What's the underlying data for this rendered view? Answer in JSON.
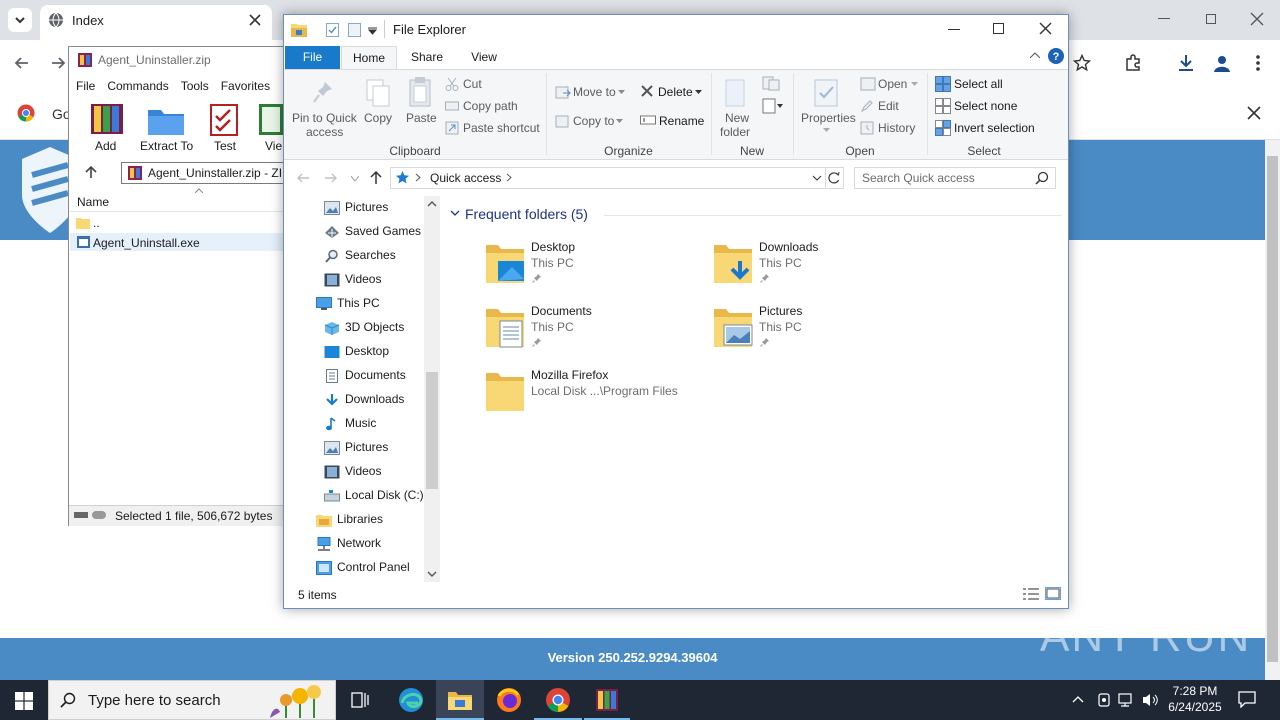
{
  "browser": {
    "tab_title": "Index",
    "bookmark_prefix": "Go",
    "site_version": "Version 250.252.9294.39604",
    "watermark": "ANY RUN"
  },
  "winrar": {
    "title": "Agent_Uninstaller.zip",
    "menu": [
      "File",
      "Commands",
      "Tools",
      "Favorites"
    ],
    "toolbar": [
      "Add",
      "Extract To",
      "Test",
      "Vie"
    ],
    "path": "Agent_Uninstaller.zip - ZIP",
    "col_name": "Name",
    "rows": [
      "..",
      "Agent_Uninstall.exe"
    ],
    "status": "Selected 1 file, 506,672 bytes"
  },
  "explorer": {
    "title": "File Explorer",
    "tabs": {
      "file": "File",
      "home": "Home",
      "share": "Share",
      "view": "View"
    },
    "ribbon": {
      "pin": [
        "Pin to Quick",
        "access"
      ],
      "copy": "Copy",
      "paste": "Paste",
      "cut": "Cut",
      "copy_path": "Copy path",
      "paste_shortcut": "Paste shortcut",
      "move_to": "Move to",
      "copy_to": "Copy to",
      "delete": "Delete",
      "rename": "Rename",
      "new_folder": [
        "New",
        "folder"
      ],
      "properties": "Properties",
      "open": "Open",
      "edit": "Edit",
      "history": "History",
      "select_all": "Select all",
      "select_none": "Select none",
      "invert_selection": "Invert selection",
      "groups": {
        "clipboard": "Clipboard",
        "organize": "Organize",
        "new": "New",
        "open": "Open",
        "select": "Select"
      }
    },
    "address": "Quick access",
    "search_placeholder": "Search Quick access",
    "nav": [
      {
        "label": "Pictures",
        "icon": "pictures-icon",
        "indent": 1
      },
      {
        "label": "Saved Games",
        "icon": "saved-games-icon",
        "indent": 1
      },
      {
        "label": "Searches",
        "icon": "searches-icon",
        "indent": 1
      },
      {
        "label": "Videos",
        "icon": "videos-icon",
        "indent": 1
      },
      {
        "label": "This PC",
        "icon": "this-pc-icon",
        "indent": 0
      },
      {
        "label": "3D Objects",
        "icon": "3d-objects-icon",
        "indent": 1
      },
      {
        "label": "Desktop",
        "icon": "desktop-icon",
        "indent": 1
      },
      {
        "label": "Documents",
        "icon": "documents-icon",
        "indent": 1
      },
      {
        "label": "Downloads",
        "icon": "downloads-icon",
        "indent": 1
      },
      {
        "label": "Music",
        "icon": "music-icon",
        "indent": 1
      },
      {
        "label": "Pictures",
        "icon": "pictures-icon",
        "indent": 1
      },
      {
        "label": "Videos",
        "icon": "videos-icon",
        "indent": 1
      },
      {
        "label": "Local Disk (C:)",
        "icon": "local-disk-icon",
        "indent": 1
      },
      {
        "label": "Libraries",
        "icon": "libraries-icon",
        "indent": 0
      },
      {
        "label": "Network",
        "icon": "network-icon",
        "indent": 0
      },
      {
        "label": "Control Panel",
        "icon": "control-panel-icon",
        "indent": 0
      }
    ],
    "frequent_header": "Frequent folders (5)",
    "folders": [
      {
        "name": "Desktop",
        "sub": "This PC",
        "pinned": true,
        "icon": "desktop-folder-icon"
      },
      {
        "name": "Downloads",
        "sub": "This PC",
        "pinned": true,
        "icon": "downloads-folder-icon"
      },
      {
        "name": "Documents",
        "sub": "This PC",
        "pinned": true,
        "icon": "documents-folder-icon"
      },
      {
        "name": "Pictures",
        "sub": "This PC",
        "pinned": true,
        "icon": "pictures-folder-icon"
      },
      {
        "name": "Mozilla Firefox",
        "sub": "Local Disk ...\\Program Files",
        "pinned": false,
        "icon": "folder-icon"
      }
    ],
    "status_items": "5 items"
  },
  "taskbar": {
    "search_placeholder": "Type here to search",
    "time": "7:28 PM",
    "date": "6/24/2025"
  },
  "colors": {
    "accent": "#1979ca",
    "site_blue": "#4a8bc6",
    "taskbar": "#1f2735",
    "folder": "#f8d775"
  }
}
